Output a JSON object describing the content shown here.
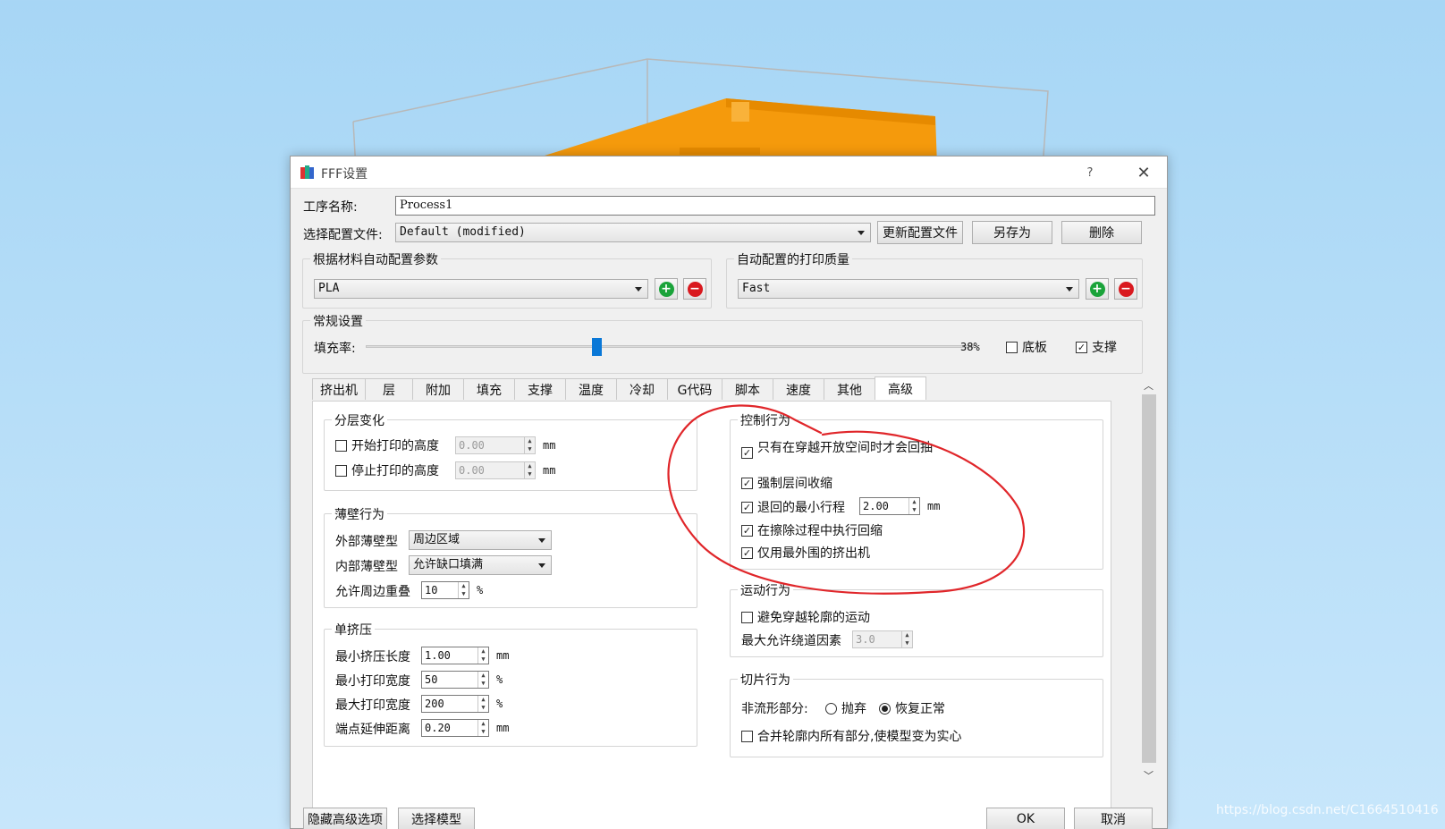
{
  "dialog": {
    "title": "FFF设置",
    "help_label": "?",
    "close_label": "✕"
  },
  "process": {
    "name_label": "工序名称:",
    "name_value": "Process1",
    "profile_label": "选择配置文件:",
    "profile_value": "Default (modified)",
    "update_button": "更新配置文件",
    "save_as_button": "另存为",
    "delete_button": "删除"
  },
  "auto_material": {
    "title": "根据材料自动配置参数",
    "value": "PLA"
  },
  "auto_quality": {
    "title": "自动配置的打印质量",
    "value": "Fast"
  },
  "general": {
    "title": "常规设置",
    "infill_label": "填充率:",
    "infill_value": "38%",
    "infill_fraction": 0.38,
    "raft_label": "底板",
    "raft_checked": false,
    "support_label": "支撑",
    "support_checked": true
  },
  "tabs": [
    "挤出机",
    "层",
    "附加",
    "填充",
    "支撑",
    "温度",
    "冷却",
    "G代码",
    "脚本",
    "速度",
    "其他",
    "高级"
  ],
  "active_tab": "高级",
  "layer_change": {
    "title": "分层变化",
    "start_label": "开始打印的高度",
    "start_value": "0.00",
    "stop_label": "停止打印的高度",
    "stop_value": "0.00",
    "unit": "mm"
  },
  "thin_wall": {
    "title": "薄壁行为",
    "outer_label": "外部薄壁型",
    "outer_value": "周边区域",
    "inner_label": "内部薄壁型",
    "inner_value": "允许缺口填满",
    "overlap_label": "允许周边重叠",
    "overlap_value": "10",
    "overlap_unit": "%"
  },
  "single_extrusion": {
    "title": "单挤压",
    "rows": [
      {
        "label": "最小挤压长度",
        "value": "1.00",
        "unit": "mm"
      },
      {
        "label": "最小打印宽度",
        "value": "50",
        "unit": "%"
      },
      {
        "label": "最大打印宽度",
        "value": "200",
        "unit": "%"
      },
      {
        "label": "端点延伸距离",
        "value": "0.20",
        "unit": "mm"
      }
    ]
  },
  "control": {
    "title": "控制行为",
    "only_retract_label": "只有在穿越开放空间时才会回抽",
    "force_retract_label": "强制层间收缩",
    "min_travel_label": "退回的最小行程",
    "min_travel_value": "2.00",
    "min_travel_unit": "mm",
    "wipe_label": "在擦除过程中执行回缩",
    "outer_only_label": "仅用最外围的挤出机"
  },
  "movement": {
    "title": "运动行为",
    "avoid_label": "避免穿越轮廓的运动",
    "detour_label": "最大允许绕道因素",
    "detour_value": "3.0"
  },
  "slicing": {
    "title": "切片行为",
    "nonmanifold_label": "非流形部分:",
    "discard_label": "抛弃",
    "restore_label": "恢复正常",
    "merge_label": "合并轮廓内所有部分,使模型变为实心"
  },
  "footer": {
    "hide_advanced": "隐藏高级选项",
    "select_model": "选择模型",
    "ok": "OK",
    "cancel": "取消"
  },
  "watermark": "https://blog.csdn.net/C1664510416",
  "colors": {
    "model": "#f59a0c",
    "annotation": "#e0262a",
    "slider": "#0a78d7"
  }
}
